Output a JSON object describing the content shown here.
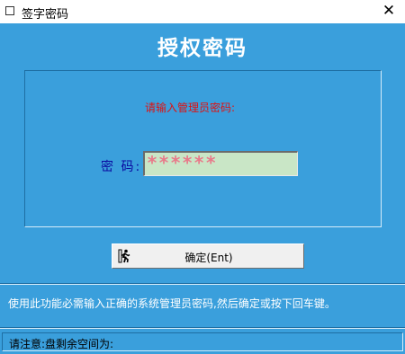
{
  "window": {
    "title": "签字密码",
    "close_glyph": "✕"
  },
  "dialog": {
    "heading": "授权密码",
    "prompt": "请输入管理员密码:",
    "password_label": "密 码:",
    "password_value": "******",
    "ok_button_label": "确定(Ent)",
    "ok_button_icon": "running-man-icon",
    "info_text": "使用此功能必需输入正确的系统管理员密码,然后确定或按下回车键。",
    "status_text": "请注意:盘剩余空间为:"
  },
  "colors": {
    "background": "#3a9fdc",
    "heading": "#ffffff",
    "prompt": "#e01010",
    "label": "#0a0aa0",
    "input_background": "#c9e6c6",
    "input_text": "#e87a8a"
  }
}
